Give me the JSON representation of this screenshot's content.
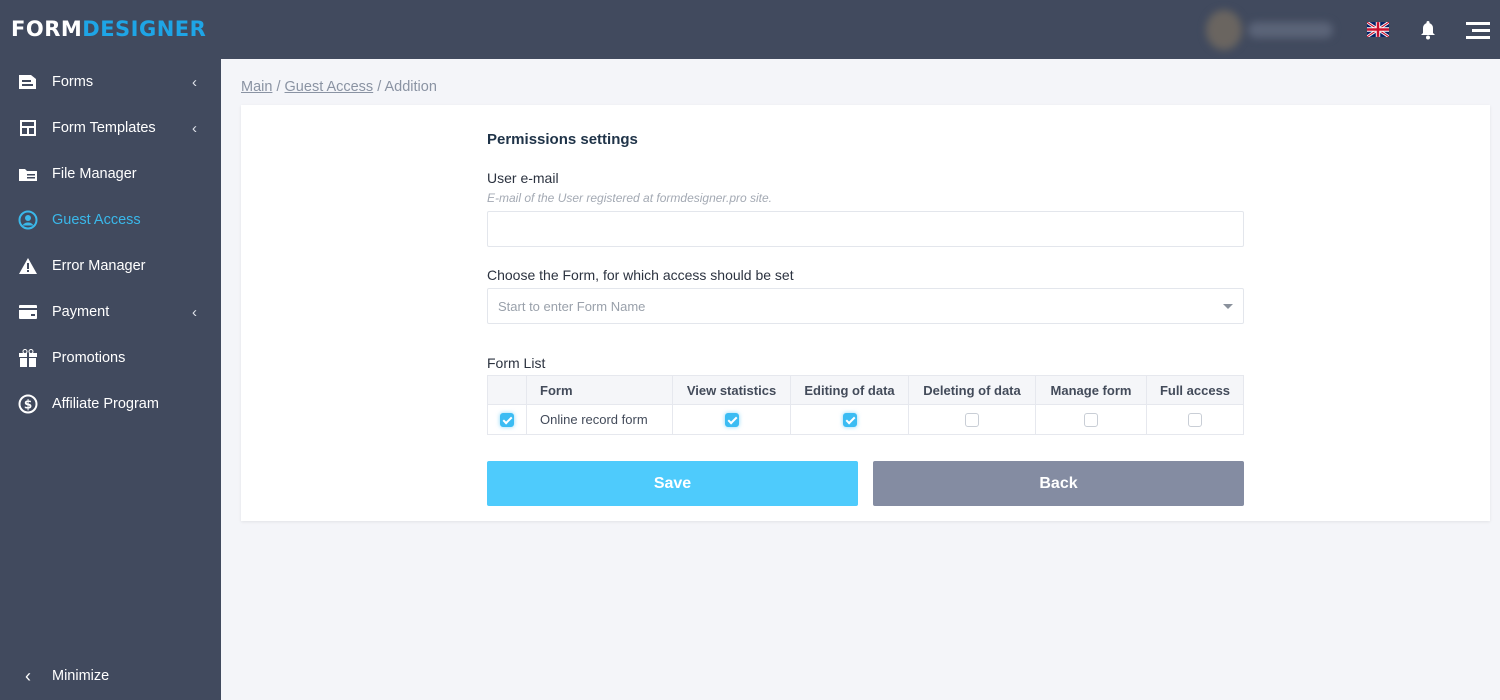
{
  "header": {
    "logo_part1": "FORM",
    "logo_part2": "DESIGNER",
    "language": "English"
  },
  "sidebar": {
    "items": [
      {
        "label": "Forms",
        "icon": "forms-icon",
        "submenu": true
      },
      {
        "label": "Form Templates",
        "icon": "templates-icon",
        "submenu": true
      },
      {
        "label": "File Manager",
        "icon": "folder-icon",
        "submenu": false
      },
      {
        "label": "Guest Access",
        "icon": "user-circle-icon",
        "submenu": false,
        "active": true
      },
      {
        "label": "Error Manager",
        "icon": "warning-icon",
        "submenu": false
      },
      {
        "label": "Payment",
        "icon": "card-icon",
        "submenu": true
      },
      {
        "label": "Promotions",
        "icon": "gift-icon",
        "submenu": false
      },
      {
        "label": "Affiliate Program",
        "icon": "dollar-icon",
        "submenu": false
      }
    ],
    "minimize": "Minimize"
  },
  "breadcrumb": {
    "main": "Main",
    "guest": "Guest Access",
    "current": "Addition",
    "sep": " / "
  },
  "form": {
    "title": "Permissions settings",
    "email_label": "User e-mail",
    "email_hint": "E-mail of the User registered at formdesigner.pro site.",
    "email_value": "",
    "choose_label": "Choose the Form, for which access should be set",
    "choose_placeholder": "Start to enter Form Name",
    "list_label": "Form List",
    "columns": [
      "",
      "Form",
      "View statistics",
      "Editing of data",
      "Deleting of data",
      "Manage form",
      "Full access"
    ],
    "rows": [
      {
        "selected": true,
        "form": "Online record form",
        "view": true,
        "edit": true,
        "delete": false,
        "manage": false,
        "full": false
      }
    ],
    "save": "Save",
    "back": "Back"
  },
  "colors": {
    "sidebar": "#414a5e",
    "accent": "#3ab8ea",
    "save": "#4ecbfc",
    "back": "#848ca2"
  }
}
